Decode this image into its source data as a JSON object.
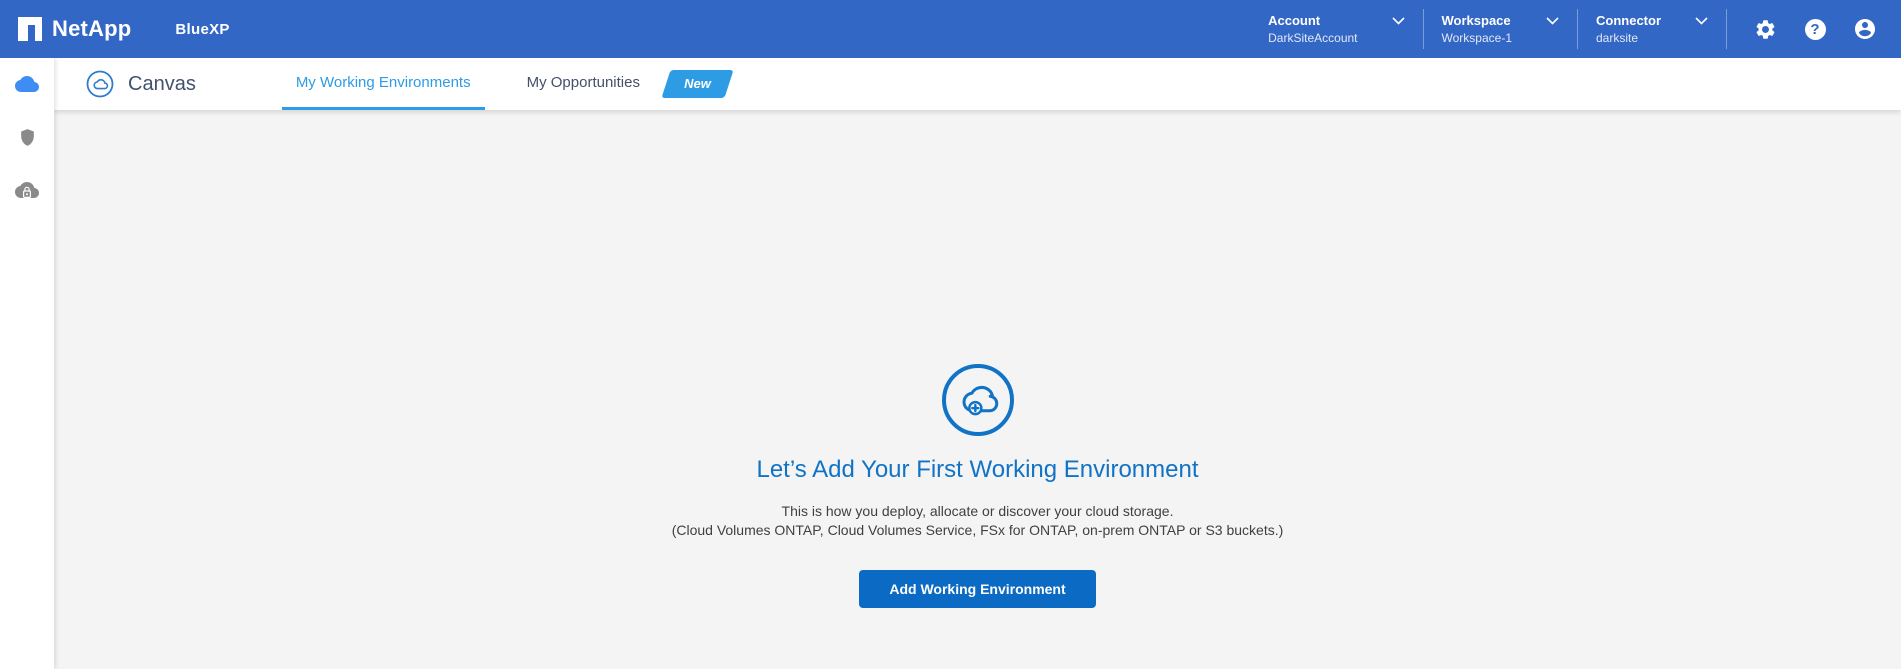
{
  "topbar": {
    "brand": "NetApp",
    "product": "BlueXP",
    "menus": [
      {
        "label": "Account",
        "value": "DarkSiteAccount"
      },
      {
        "label": "Workspace",
        "value": "Workspace-1"
      },
      {
        "label": "Connector",
        "value": "darksite"
      }
    ],
    "help_glyph": "?"
  },
  "sidebar": {
    "items": [
      {
        "id": "canvas",
        "icon": "cloud-icon",
        "active": true
      },
      {
        "id": "protection",
        "icon": "shield-icon",
        "active": false
      },
      {
        "id": "cloud-security",
        "icon": "cloud-lock-icon",
        "active": false
      }
    ]
  },
  "canvas": {
    "title": "Canvas",
    "tabs": [
      {
        "label": "My Working Environments",
        "active": true
      },
      {
        "label": "My Opportunities",
        "active": false
      }
    ],
    "new_badge": "New"
  },
  "empty_state": {
    "heading": "Let’s Add Your First Working Environment",
    "line1": "This is how you deploy, allocate or discover your cloud storage.",
    "line2": "(Cloud Volumes ONTAP, Cloud Volumes Service, FSx for ONTAP, on-prem ONTAP or S3 buckets.)",
    "button_label": "Add Working Environment"
  },
  "colors": {
    "topbar_blue": "#3367c5",
    "accent_sky": "#2d9ce5",
    "primary_blue": "#1073c6",
    "button_blue": "#0b6ac3",
    "canvas_bg": "#f4f4f4",
    "inactive_icon_gray": "#8a8a8a"
  }
}
